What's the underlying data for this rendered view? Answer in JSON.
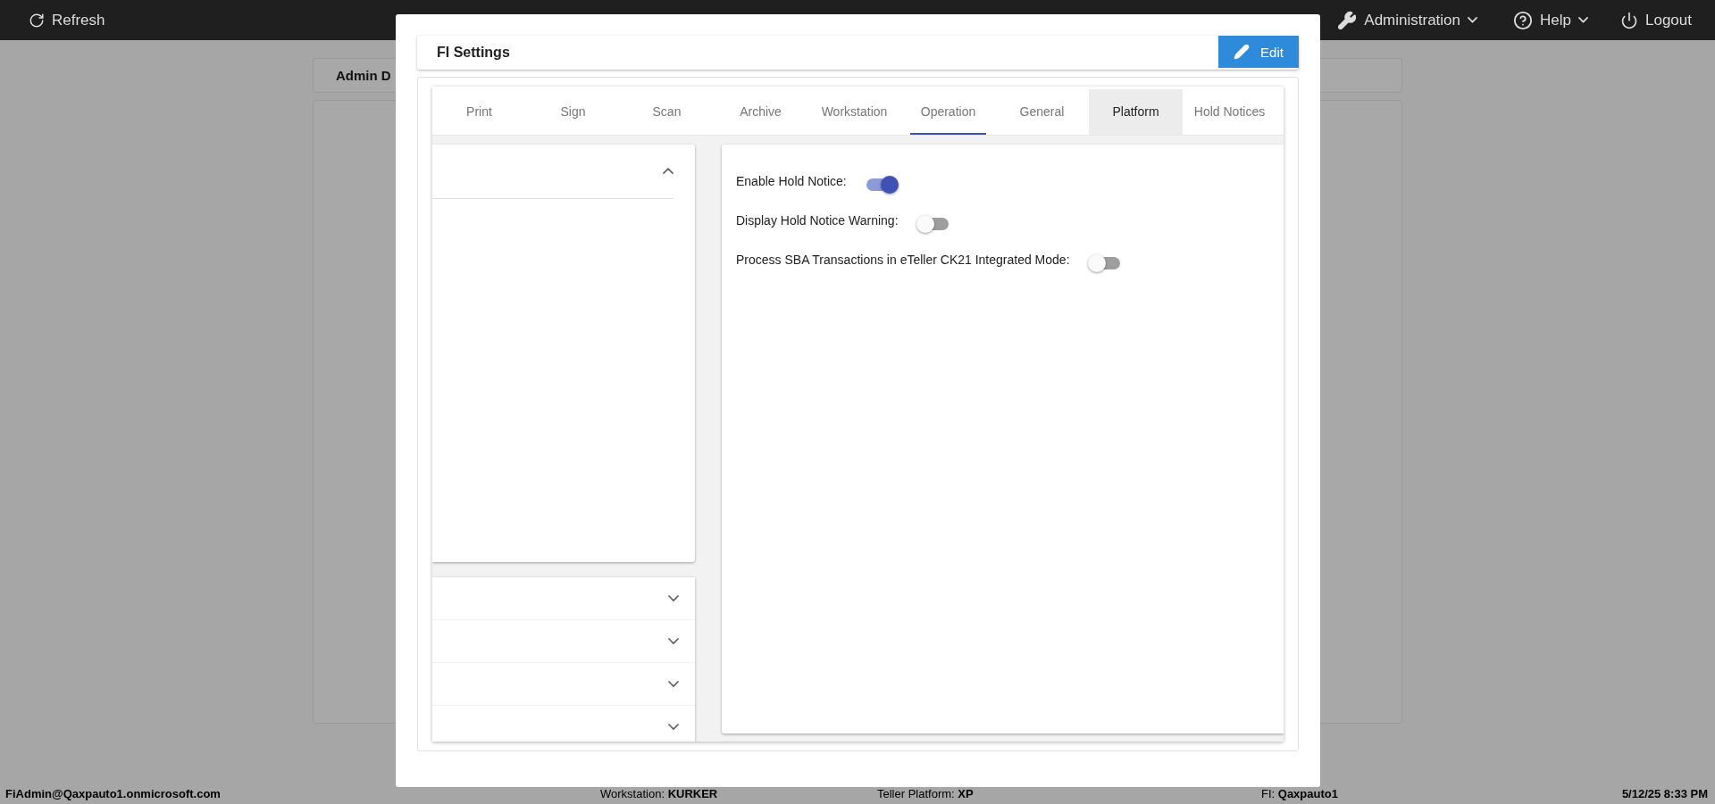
{
  "top_bar": {
    "refresh": "Refresh",
    "menus": [
      {
        "kind": "admin",
        "label": "Administration"
      },
      {
        "kind": "help",
        "label": "Help"
      }
    ],
    "logout": "Logout"
  },
  "background": {
    "card_title": "Admin D"
  },
  "dialog": {
    "title": "FI Settings",
    "edit_button": "Edit",
    "tabs": [
      {
        "label": "Print",
        "selected": false,
        "underlined": false
      },
      {
        "label": "Sign",
        "selected": false,
        "underlined": false
      },
      {
        "label": "Scan",
        "selected": false,
        "underlined": false
      },
      {
        "label": "Archive",
        "selected": false,
        "underlined": false
      },
      {
        "label": "Workstation",
        "selected": false,
        "underlined": false
      },
      {
        "label": "Operation",
        "selected": false,
        "underlined": true
      },
      {
        "label": "General",
        "selected": false,
        "underlined": false
      },
      {
        "label": "Platform",
        "selected": true,
        "underlined": false
      },
      {
        "label": "Hold Notices",
        "selected": false,
        "underlined": false
      }
    ],
    "sections": [
      {
        "expanded": true
      },
      {
        "expanded": false
      },
      {
        "expanded": false
      },
      {
        "expanded": false
      },
      {
        "expanded": false
      }
    ],
    "settings": [
      {
        "label": "Enable Hold Notice:",
        "on": true
      },
      {
        "label": "Display Hold Notice Warning:",
        "on": false
      },
      {
        "label": "Process SBA Transactions in eTeller CK21 Integrated Mode:",
        "on": false
      }
    ]
  },
  "status_bar": {
    "user": "FiAdmin@Qaxpauto1.onmicrosoft.com",
    "workstation": "Workstation: **KURKER**",
    "platform": "Teller Platform: **XP**",
    "fi": "FI: **Qaxpauto1**",
    "datetime": "5/12/25 8:33 PM"
  }
}
